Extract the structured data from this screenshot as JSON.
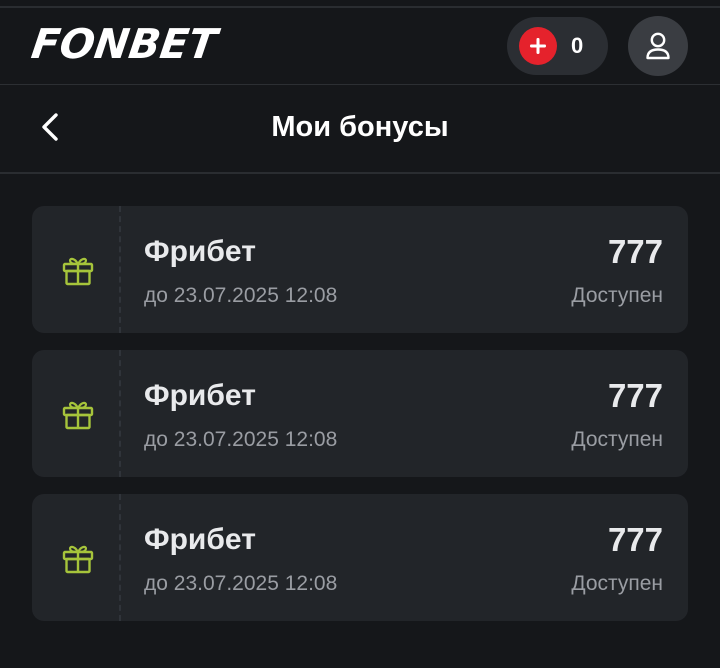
{
  "header": {
    "logo_text": "FONBET",
    "balance_value": "0",
    "accent_red": "#e5222c",
    "icons": {
      "deposit": "plus-icon",
      "profile": "user-icon"
    }
  },
  "title_bar": {
    "title": "Мои бонусы",
    "back_icon": "chevron-left-icon"
  },
  "bonuses": [
    {
      "name": "Фрибет",
      "expiry": "до 23.07.2025 12:08",
      "amount": "777",
      "status": "Доступен",
      "icon": "gift-icon"
    },
    {
      "name": "Фрибет",
      "expiry": "до 23.07.2025 12:08",
      "amount": "777",
      "status": "Доступен",
      "icon": "gift-icon"
    },
    {
      "name": "Фрибет",
      "expiry": "до 23.07.2025 12:08",
      "amount": "777",
      "status": "Доступен",
      "icon": "gift-icon"
    }
  ],
  "colors": {
    "background": "#15171a",
    "card": "#222529",
    "gift_icon": "#a6c43b",
    "muted_text": "#9a9da3"
  }
}
